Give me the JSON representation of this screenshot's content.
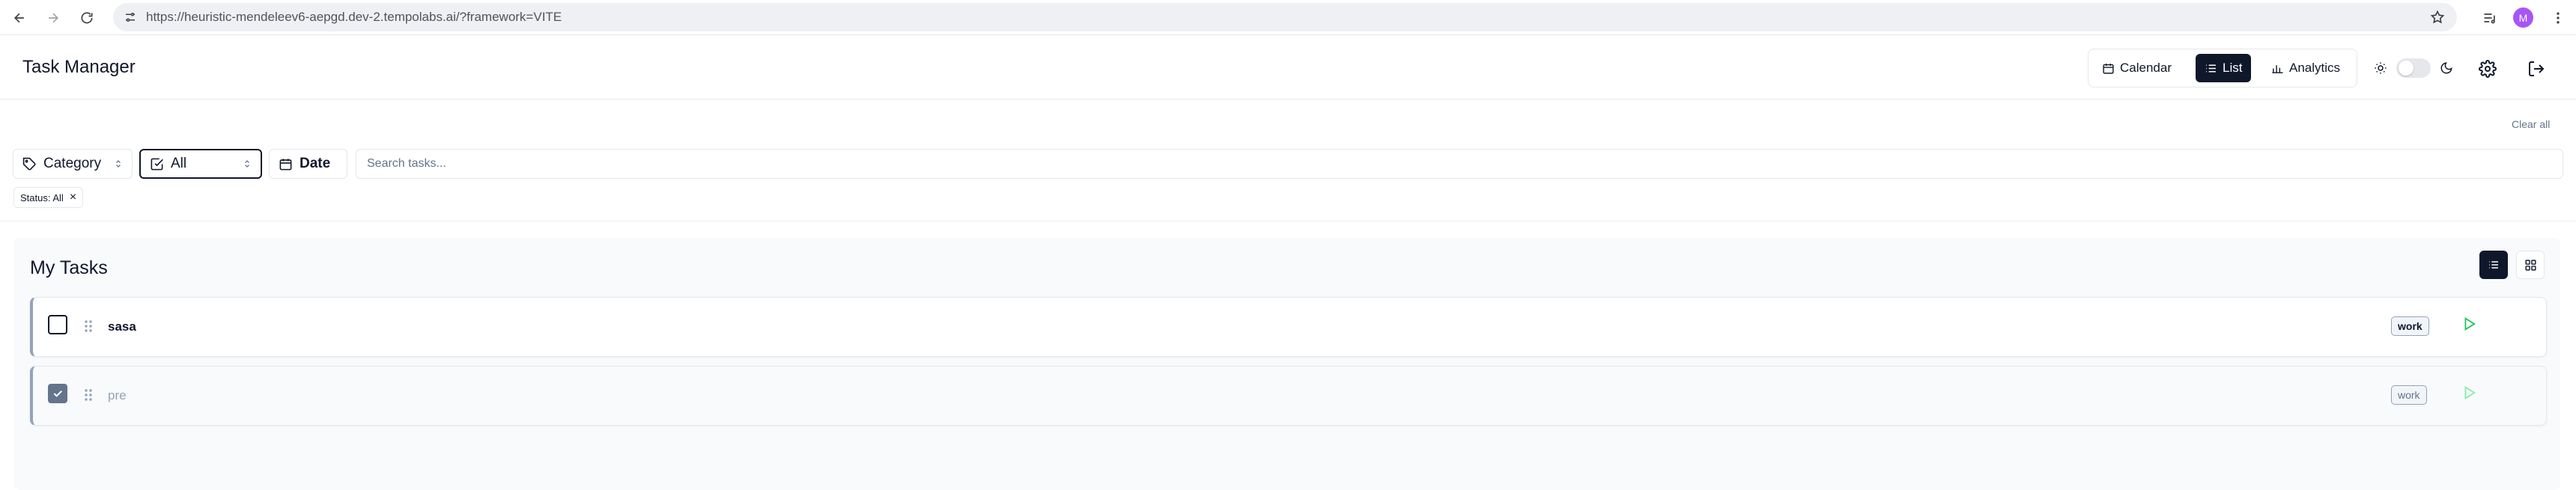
{
  "browser": {
    "url_host": "https://heuristic-mendeleev6-aepgd.dev-2.tempolabs.ai",
    "url_path": "/?framework=VITE",
    "profile_initial": "M"
  },
  "header": {
    "title": "Task Manager",
    "views": [
      {
        "label": "Calendar",
        "icon": "calendar-icon",
        "active": false
      },
      {
        "label": "List",
        "icon": "list-icon",
        "active": true
      },
      {
        "label": "Analytics",
        "icon": "bar-chart-icon",
        "active": false
      }
    ]
  },
  "filters": {
    "clear_all": "Clear all",
    "category_label": "Category",
    "status_value": "All",
    "date_label": "Date",
    "search_placeholder": "Search tasks...",
    "active_chip": "Status: All"
  },
  "tasks_panel": {
    "title": "My Tasks",
    "tasks": [
      {
        "name": "sasa",
        "tag": "work",
        "completed": false
      },
      {
        "name": "pre",
        "tag": "work",
        "completed": true
      }
    ]
  },
  "colors": {
    "primary": "#0f172a",
    "play": "#22c55e",
    "profile": "#a855f7"
  }
}
